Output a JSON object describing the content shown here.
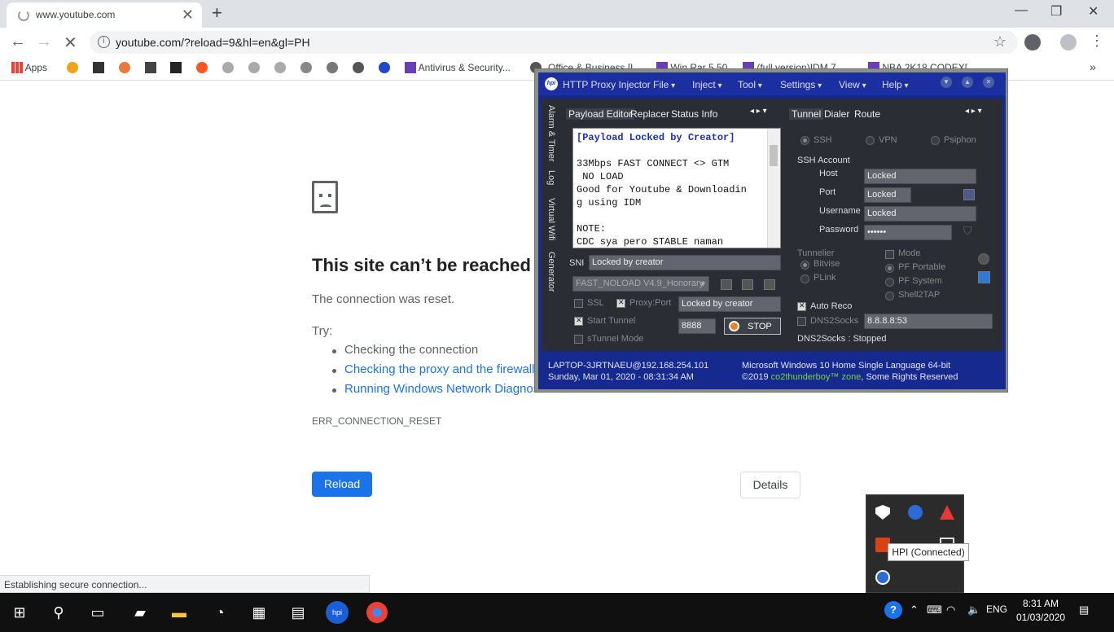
{
  "browser": {
    "tab_title": "www.youtube.com",
    "url": "youtube.com/?reload=9&hl=en&gl=PH",
    "bookmarks": [
      "Apps",
      "Antivirus & Security...",
      "Office & Business [L...",
      "Win Rar 5.50",
      "(full version)IDM 7....",
      "NBA 2K18 CODEX[..."
    ],
    "overflow": "»"
  },
  "error_page": {
    "title": "This site can’t be reached",
    "description": "The connection was reset.",
    "try_label": "Try:",
    "suggestions": [
      "Checking the connection",
      "Checking the proxy and the firewall",
      "Running Windows Network Diagnostics"
    ],
    "code": "ERR_CONNECTION_RESET",
    "reload_label": "Reload",
    "details_label": "Details",
    "status": "Establishing secure connection..."
  },
  "hpi": {
    "title": "HTTP Proxy Injector",
    "logo": "hpi",
    "menus": [
      "File",
      "Inject",
      "Tool",
      "Settings",
      "View",
      "Help"
    ],
    "side_tabs": [
      "Alarm & Timer",
      "Log",
      "Virtual Wifi",
      "Generator"
    ],
    "left_tabs": [
      "Payload Editor",
      "Replacer",
      "Status Info"
    ],
    "right_tabs": [
      "Tunnel",
      "Dialer",
      "Route"
    ],
    "payload_lines": [
      "[Payload Locked by Creator]",
      "",
      "33Mbps FAST CONNECT <>  GTM",
      " NO LOAD",
      "Good for Youtube & Downloadin",
      "g using IDM",
      "",
      "NOTE:",
      "CDC sya pero STABLE naman"
    ],
    "sni_label": "SNI",
    "sni_value": "Locked by creator",
    "profile": "FAST_NOLOAD V4.9_Honorary",
    "ssl_label": "SSL",
    "proxy_port_label": "Proxy:Port",
    "proxy_value": "Locked by creator",
    "start_tunnel_label": "Start Tunnel",
    "port_value": "8888",
    "stop_label": "STOP",
    "stunnel_label": "sTunnel Mode",
    "modes": [
      "SSH",
      "VPN",
      "Psiphon"
    ],
    "ssh_account_label": "SSH Account",
    "host_label": "Host",
    "host_value": "Locked",
    "port_label": "Port",
    "port_field": "Locked",
    "username_label": "Username",
    "username_value": "Locked",
    "password_label": "Password",
    "password_value": "••••••",
    "tunnelier_label": "Tunnelier",
    "tunneliers": [
      "Bitvise",
      "PLink"
    ],
    "mode_label": "Mode",
    "mode_options": [
      "PF Portable",
      "PF System",
      "Shell2TAP"
    ],
    "auto_reco_label": "Auto Reco",
    "dns2socks_label": "DNS2Socks",
    "dns_value": "8.8.8.8:53",
    "dns_status": "DNS2Socks : Stopped",
    "footer_host": "LAPTOP-3JRTNAEU@192.168.254.101",
    "footer_date": "Sunday, Mar 01, 2020 - 08:31:34 AM",
    "footer_os": "Microsoft Windows 10 Home Single Language 64-bit",
    "footer_copy_pre": "©2019",
    "footer_author": "co2thunderboy™ zone",
    "footer_copy_post": ", Some Rights Reserved"
  },
  "tray": {
    "tooltip": "HPI (Connected)"
  },
  "taskbar": {
    "language": "ENG",
    "time": "8:31 AM",
    "date": "01/03/2020"
  }
}
